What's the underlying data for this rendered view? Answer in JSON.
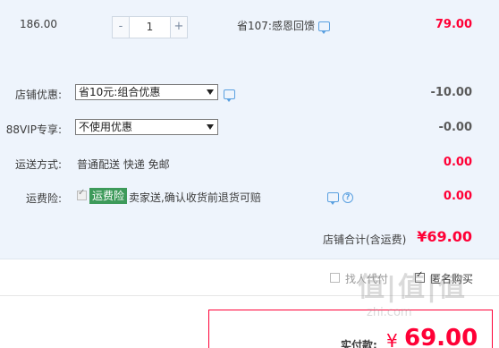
{
  "item": {
    "price": "186.00",
    "qty_minus": "-",
    "qty_value": "1",
    "qty_plus": "+",
    "promo": "省107:感恩回馈",
    "total": "79.00"
  },
  "shop_discount": {
    "label": "店铺优惠:",
    "selected": "省10元:组合优惠",
    "value": "-10.00"
  },
  "vip": {
    "label": "88VIP专享:",
    "selected": "不使用优惠",
    "value": "-0.00"
  },
  "shipping": {
    "label": "运送方式:",
    "text": "普通配送 快递 免邮",
    "value": "0.00"
  },
  "insurance": {
    "label": "运费险:",
    "tag": "运费险",
    "text": "卖家送,确认收货前退货可赔",
    "value": "0.00"
  },
  "subtotal": {
    "label": "店铺合计(含运费)",
    "value": "¥69.00"
  },
  "options": {
    "pay_for_me": "找人代付",
    "anonymous": "匿名购买"
  },
  "payment": {
    "label": "实付款:",
    "currency": "¥",
    "amount": "69.00"
  },
  "watermark": {
    "main": "值|值|值",
    "sub": "zhi.com"
  },
  "colors": {
    "accent_red": "#ff0036",
    "panel_bg": "#eef4fc",
    "tag_green": "#3d9a5a"
  }
}
